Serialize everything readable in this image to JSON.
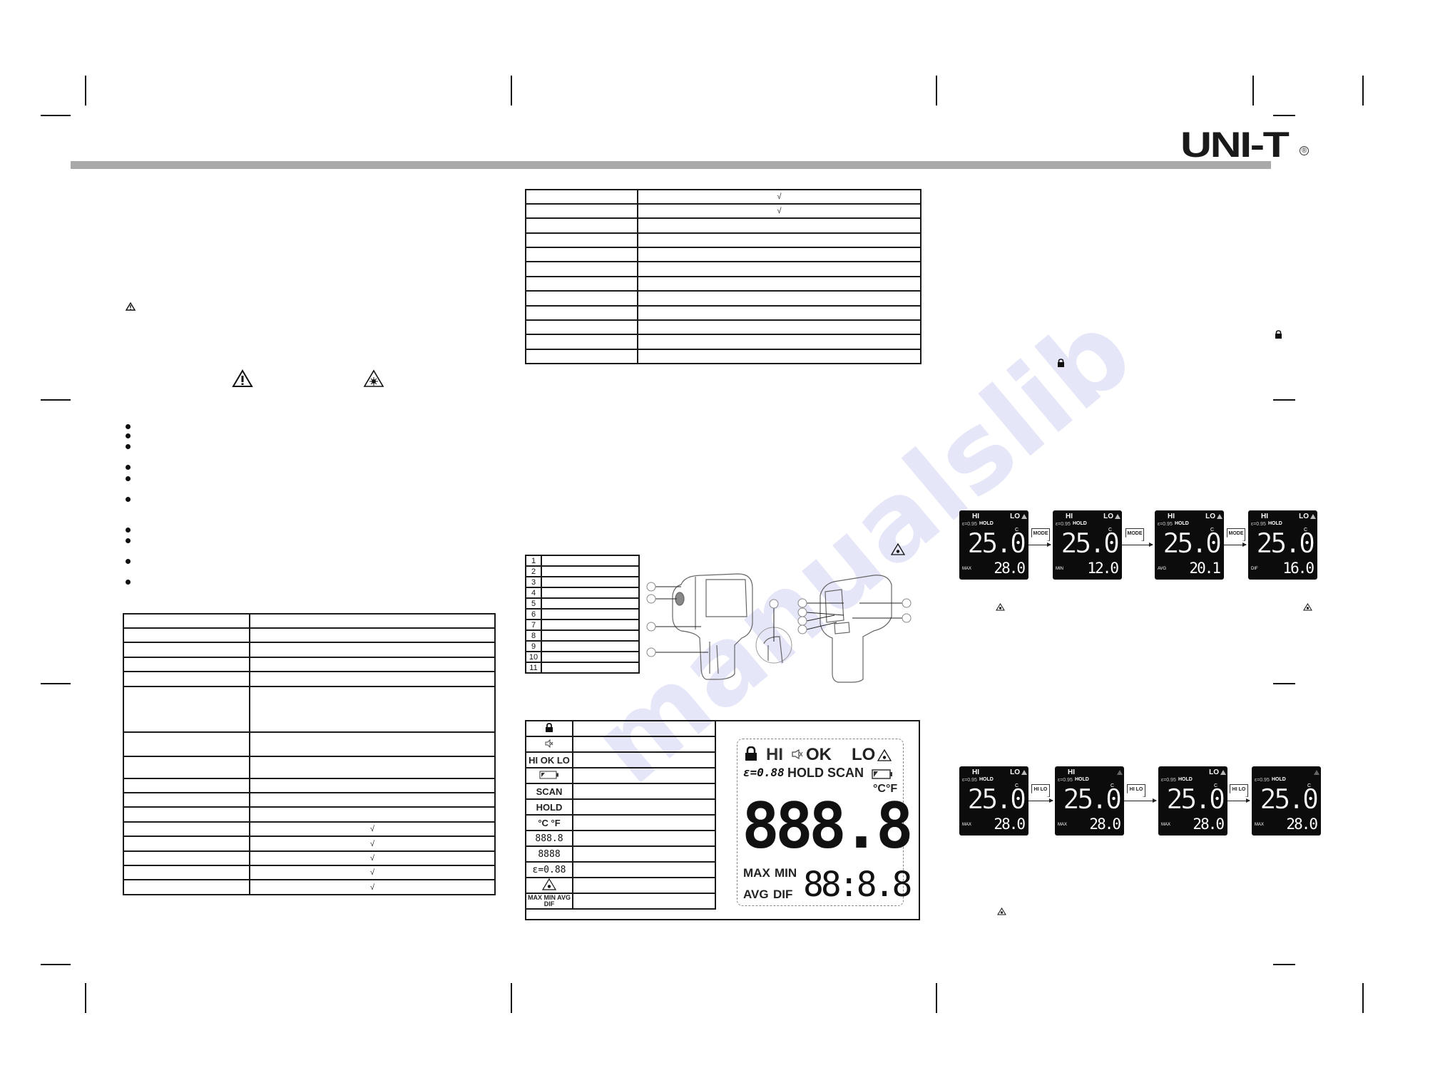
{
  "header": {
    "brand": "UNI-T",
    "registered_mark": "®",
    "bar_color": "#a9a9a9"
  },
  "watermark": {
    "text": "manualslib",
    "color": "#c9c9f3"
  },
  "left_page": {
    "icons": [
      "warning-small-icon",
      "warning-exclamation-icon",
      "laser-warning-icon"
    ],
    "bullet_count": 10,
    "spec_table": {
      "rows": [
        {
          "label": "",
          "value": ""
        },
        {
          "label": "",
          "value": ""
        },
        {
          "label": "",
          "value": ""
        },
        {
          "label": "",
          "value": ""
        },
        {
          "label": "",
          "value": ""
        },
        {
          "label": "",
          "value": ""
        },
        {
          "label": "",
          "value": ""
        },
        {
          "label": "",
          "value": ""
        },
        {
          "label": "",
          "value": ""
        },
        {
          "label": "",
          "value": ""
        },
        {
          "label": "",
          "value": ""
        },
        {
          "label": "",
          "value": "√"
        },
        {
          "label": "",
          "value": "√"
        },
        {
          "label": "",
          "value": "√"
        },
        {
          "label": "",
          "value": "√"
        },
        {
          "label": "",
          "value": "√"
        }
      ]
    }
  },
  "middle_page": {
    "spec_table_cont": {
      "rows": [
        {
          "label": "",
          "value": "√"
        },
        {
          "label": "",
          "value": "√"
        },
        {
          "label": "",
          "value": ""
        },
        {
          "label": "",
          "value": ""
        },
        {
          "label": "",
          "value": ""
        },
        {
          "label": "",
          "value": ""
        },
        {
          "label": "",
          "value": ""
        },
        {
          "label": "",
          "value": ""
        },
        {
          "label": "",
          "value": ""
        },
        {
          "label": "",
          "value": ""
        },
        {
          "label": "",
          "value": ""
        },
        {
          "label": "",
          "value": ""
        }
      ]
    },
    "parts_table": {
      "numbers": [
        "1",
        "2",
        "3",
        "4",
        "5",
        "6",
        "7",
        "8",
        "9",
        "10",
        "11"
      ]
    },
    "lcd_symbols": [
      {
        "symbol": "lock-icon",
        "text": ""
      },
      {
        "symbol": "speaker-mute-icon",
        "text": ""
      },
      {
        "symbol": "text",
        "text": "HI OK LO"
      },
      {
        "symbol": "battery-icon",
        "text": ""
      },
      {
        "symbol": "text",
        "text": "SCAN"
      },
      {
        "symbol": "text",
        "text": "HOLD"
      },
      {
        "symbol": "text",
        "text": "°C °F"
      },
      {
        "symbol": "segment",
        "text": "888.8"
      },
      {
        "symbol": "segment",
        "text": "8888"
      },
      {
        "symbol": "segment",
        "text": "ε=0.88"
      },
      {
        "symbol": "laser-warning-icon",
        "text": ""
      },
      {
        "symbol": "text",
        "text": "MAX MIN AVG DIF"
      }
    ],
    "lcd_display": {
      "row1": {
        "hi": "HI",
        "ok": "OK",
        "lo": "LO"
      },
      "row2": {
        "emissivity": "ε=0.88",
        "hold": "HOLD",
        "scan": "SCAN"
      },
      "units": "°C°F",
      "main_digits": "888.8",
      "modes": {
        "max": "MAX",
        "min": "MIN",
        "avg": "AVG",
        "dif": "DIF"
      },
      "secondary_digits": "88:8.8"
    }
  },
  "right_page": {
    "mode_sequence": {
      "button_label": "MODE",
      "screens": [
        {
          "hi": "HI",
          "lo": "LO",
          "emissivity": "ε=0.95",
          "hold": "HOLD",
          "unit": "C",
          "main": "25.0",
          "mode": "MAX",
          "secondary": "28.0"
        },
        {
          "hi": "HI",
          "lo": "LO",
          "emissivity": "ε=0.95",
          "hold": "HOLD",
          "unit": "C",
          "main": "25.0",
          "mode": "MIN",
          "secondary": "12.0"
        },
        {
          "hi": "HI",
          "lo": "LO",
          "emissivity": "ε=0.95",
          "hold": "HOLD",
          "unit": "C",
          "main": "25.0",
          "mode": "AVG",
          "secondary": "20.1"
        },
        {
          "hi": "HI",
          "lo": "LO",
          "emissivity": "ε=0.95",
          "hold": "HOLD",
          "unit": "C",
          "main": "25.0",
          "mode": "DIF",
          "secondary": "16.0"
        }
      ]
    },
    "hilo_sequence": {
      "button_label": "HI LO",
      "screens": [
        {
          "hi": "HI",
          "lo": "LO",
          "emissivity": "ε=0.95",
          "hold": "HOLD",
          "unit": "C",
          "main": "25.0",
          "mode": "MAX",
          "secondary": "28.0"
        },
        {
          "hi": "HI",
          "lo": "",
          "emissivity": "ε=0.95",
          "hold": "HOLD",
          "unit": "C",
          "main": "25.0",
          "mode": "MAX",
          "secondary": "28.0"
        },
        {
          "hi": "",
          "lo": "LO",
          "emissivity": "ε=0.95",
          "hold": "HOLD",
          "unit": "C",
          "main": "25.0",
          "mode": "MAX",
          "secondary": "28.0"
        },
        {
          "hi": "",
          "lo": "",
          "emissivity": "ε=0.95",
          "hold": "HOLD",
          "unit": "C",
          "main": "25.0",
          "mode": "MAX",
          "secondary": "28.0"
        }
      ]
    }
  }
}
